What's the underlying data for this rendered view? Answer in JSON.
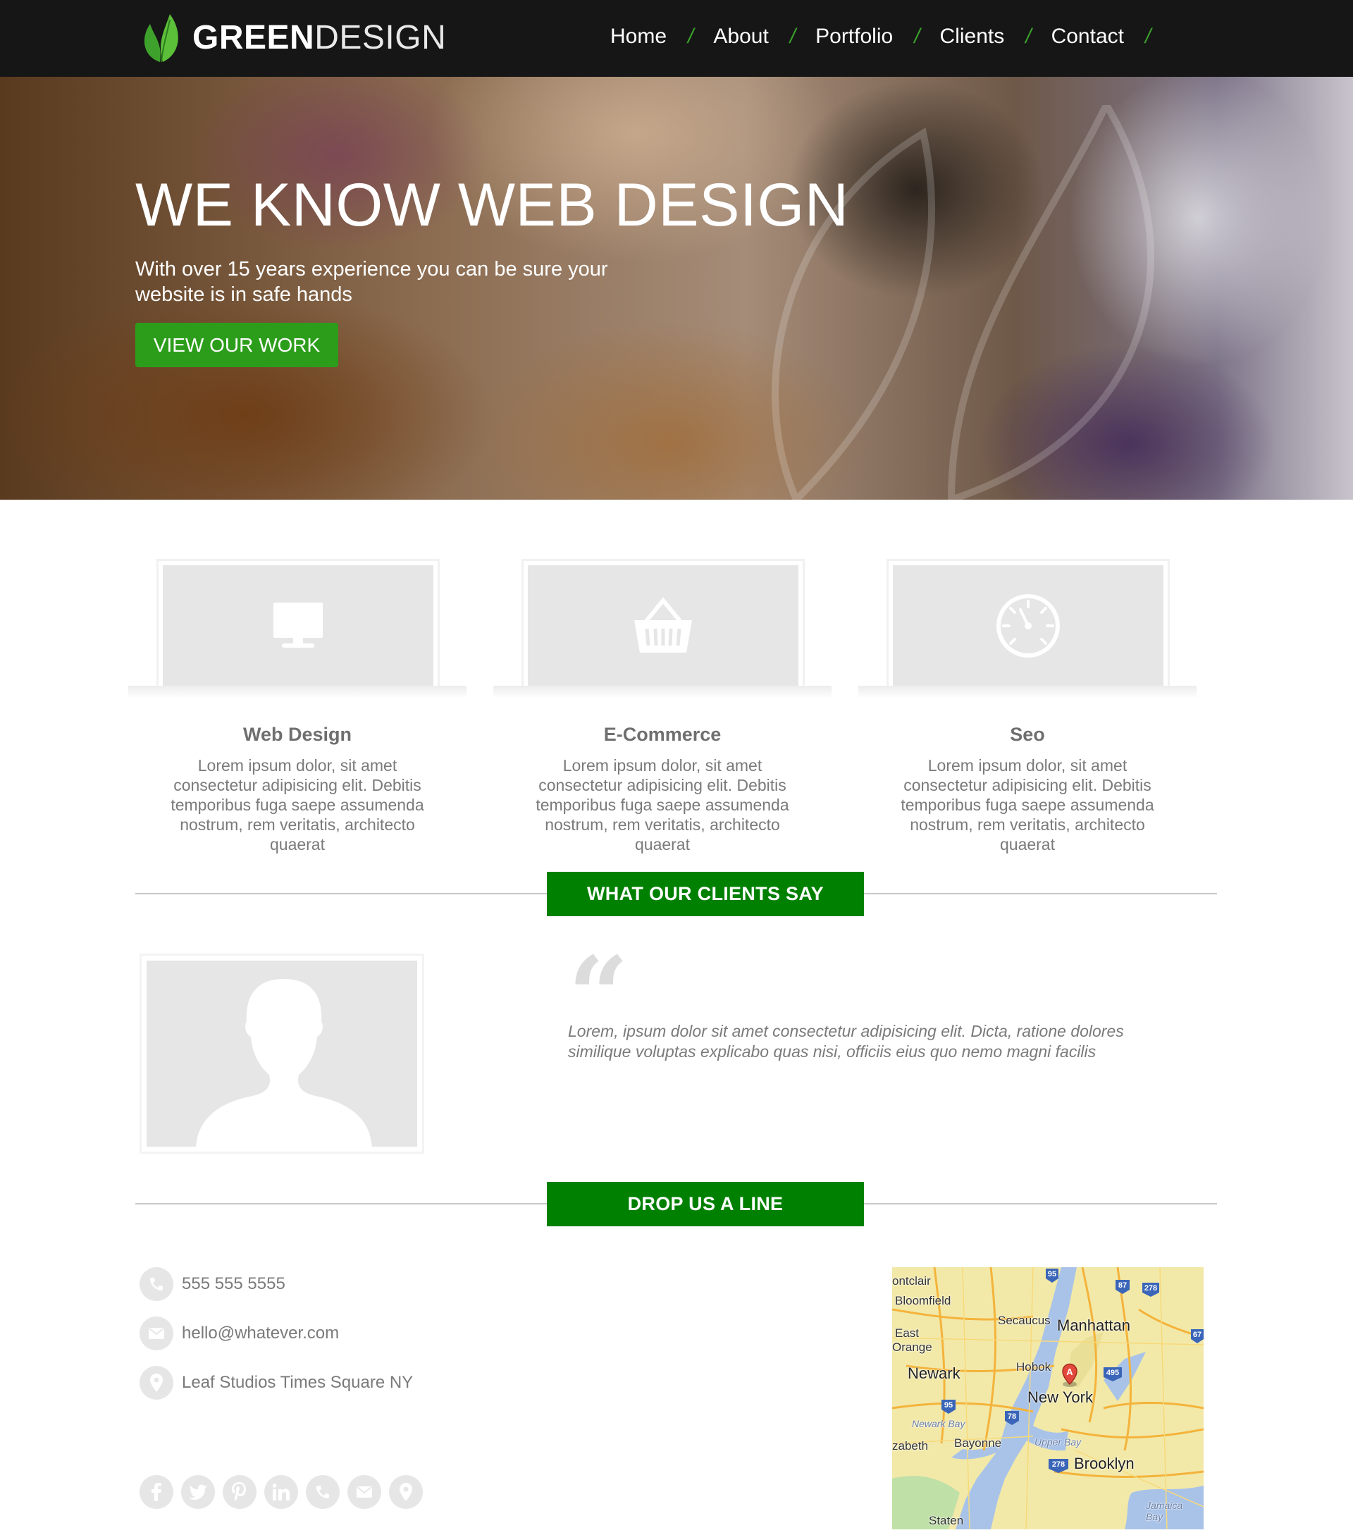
{
  "brand": {
    "name_bold": "GREEN",
    "name_light": "DESIGN"
  },
  "nav": {
    "items": [
      {
        "label": "Home"
      },
      {
        "label": "About"
      },
      {
        "label": "Portfolio"
      },
      {
        "label": "Clients"
      },
      {
        "label": "Contact"
      }
    ],
    "separator": "/"
  },
  "hero": {
    "title": "WE KNOW WEB DESIGN",
    "subtitle": "With over 15 years experience you can be sure your website is in safe hands",
    "cta_label": "VIEW OUR WORK"
  },
  "services": [
    {
      "title": "Web Design",
      "icon": "monitor-icon",
      "text": "Lorem ipsum dolor, sit amet consectetur adipisicing elit. Debitis temporibus fuga saepe assumenda nostrum, rem veritatis, architecto quaerat"
    },
    {
      "title": "E-Commerce",
      "icon": "basket-icon",
      "text": "Lorem ipsum dolor, sit amet consectetur adipisicing elit. Debitis temporibus fuga saepe assumenda nostrum, rem veritatis, architecto quaerat"
    },
    {
      "title": "Seo",
      "icon": "speedometer-icon",
      "text": "Lorem ipsum dolor, sit amet consectetur adipisicing elit. Debitis temporibus fuga saepe assumenda nostrum, rem veritatis, architecto quaerat"
    }
  ],
  "testimonials": {
    "heading": "WHAT OUR CLIENTS SAY",
    "quote": "Lorem, ipsum dolor sit amet consectetur adipisicing elit. Dicta, ratione dolores similique voluptas explicabo quas nisi, officiis eius quo nemo magni facilis"
  },
  "contact": {
    "heading": "DROP US A LINE",
    "phone": "555 555 5555",
    "email": "hello@whatever.com",
    "address": "Leaf Studios Times Square NY"
  },
  "socials": [
    "facebook-icon",
    "twitter-icon",
    "pinterest-icon",
    "linkedin-icon",
    "phone-icon",
    "mail-icon",
    "location-icon"
  ],
  "map": {
    "labels": {
      "montclair": "ontclair",
      "bloomfield": "Bloomfield",
      "east": "East",
      "orange": "Orange",
      "secaucus": "Secaucus",
      "manhattan": "Manhattan",
      "hoboken": "Hobok",
      "newark": "Newark",
      "newyork": "New York",
      "newarkbay": "Newark Bay",
      "elizabeth": "zabeth",
      "bayonne": "Bayonne",
      "upperbay": "Upper Bay",
      "brooklyn": "Brooklyn",
      "jamaicabay": "Jamaica Bay",
      "staten": "Staten",
      "marker": "A",
      "shield_95a": "95",
      "shield_87": "87",
      "shield_278a": "278",
      "shield_495": "495",
      "shield_95b": "95",
      "shield_78": "78",
      "shield_278b": "278",
      "shield_67": "67"
    }
  },
  "colors": {
    "header_bg": "#161616",
    "accent_green": "#008000",
    "button_green": "#2c9d1b",
    "nav_separator": "#3aa02a",
    "placeholder_gray": "#e6e6e6",
    "body_text": "#7a7a7a"
  }
}
